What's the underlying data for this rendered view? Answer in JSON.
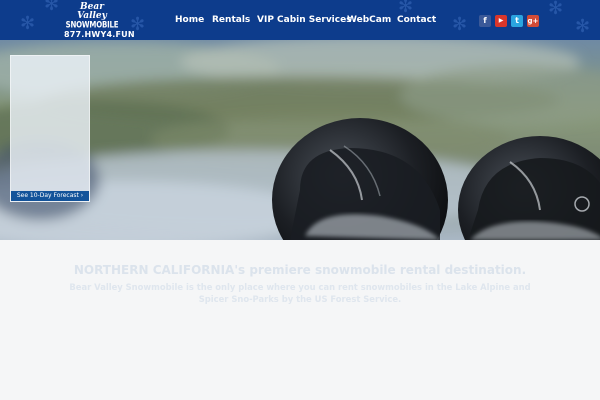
{
  "header": {
    "logo": {
      "line1": "Bear Valley",
      "line2": "SNOWMOBILE",
      "phone": "877.HWY4.FUN"
    },
    "nav": [
      {
        "label": "Home"
      },
      {
        "label": "Rentals"
      },
      {
        "label": "VIP Cabin Services"
      },
      {
        "label": "WebCam"
      },
      {
        "label": "Contact"
      }
    ],
    "social": [
      {
        "icon": "facebook-icon",
        "glyph": "f",
        "color": "#3b5998"
      },
      {
        "icon": "youtube-icon",
        "glyph": "▶",
        "color": "#d9362a"
      },
      {
        "icon": "twitter-icon",
        "glyph": "t",
        "color": "#2aa4e0"
      },
      {
        "icon": "google-plus-icon",
        "glyph": "g+",
        "color": "#d24b36"
      }
    ],
    "background_color": "#0d3c8c"
  },
  "hero": {
    "forecast_link": "See 10-Day Forecast ›"
  },
  "intro": {
    "headline": "NORTHERN CALIFORNIA's premiere snowmobile rental destination.",
    "subtext": "Bear Valley Snowmobile is the only place where you can rent snowmobiles in the Lake Alpine and Spicer Sno-Parks by the US Forest Service."
  }
}
